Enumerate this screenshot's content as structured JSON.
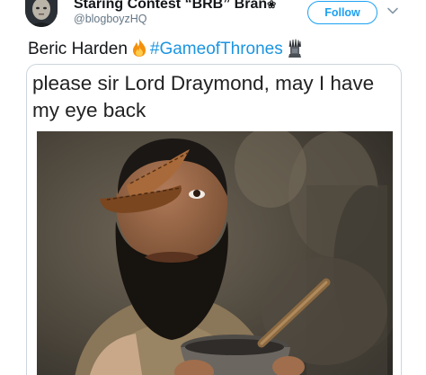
{
  "tweet": {
    "author": {
      "display_name": "Staring Contest “BRB” Bran",
      "badge_icon": "gear-icon",
      "handle": "@blogboyzHQ"
    },
    "follow_label": "Follow",
    "menu_icon": "chevron-down-icon",
    "text": {
      "plain": "Beric Harden",
      "emoji": "fire-icon",
      "hashtag": "#GameofThrones",
      "trailing_emoji": "iron-throne-icon"
    },
    "meme": {
      "caption": "please sir Lord Draymond, may I have my eye back"
    }
  },
  "colors": {
    "accent": "#1da1f2",
    "hashtag": "#1b95e0",
    "secondary_text": "#657786",
    "border": "#ccd6dd"
  }
}
